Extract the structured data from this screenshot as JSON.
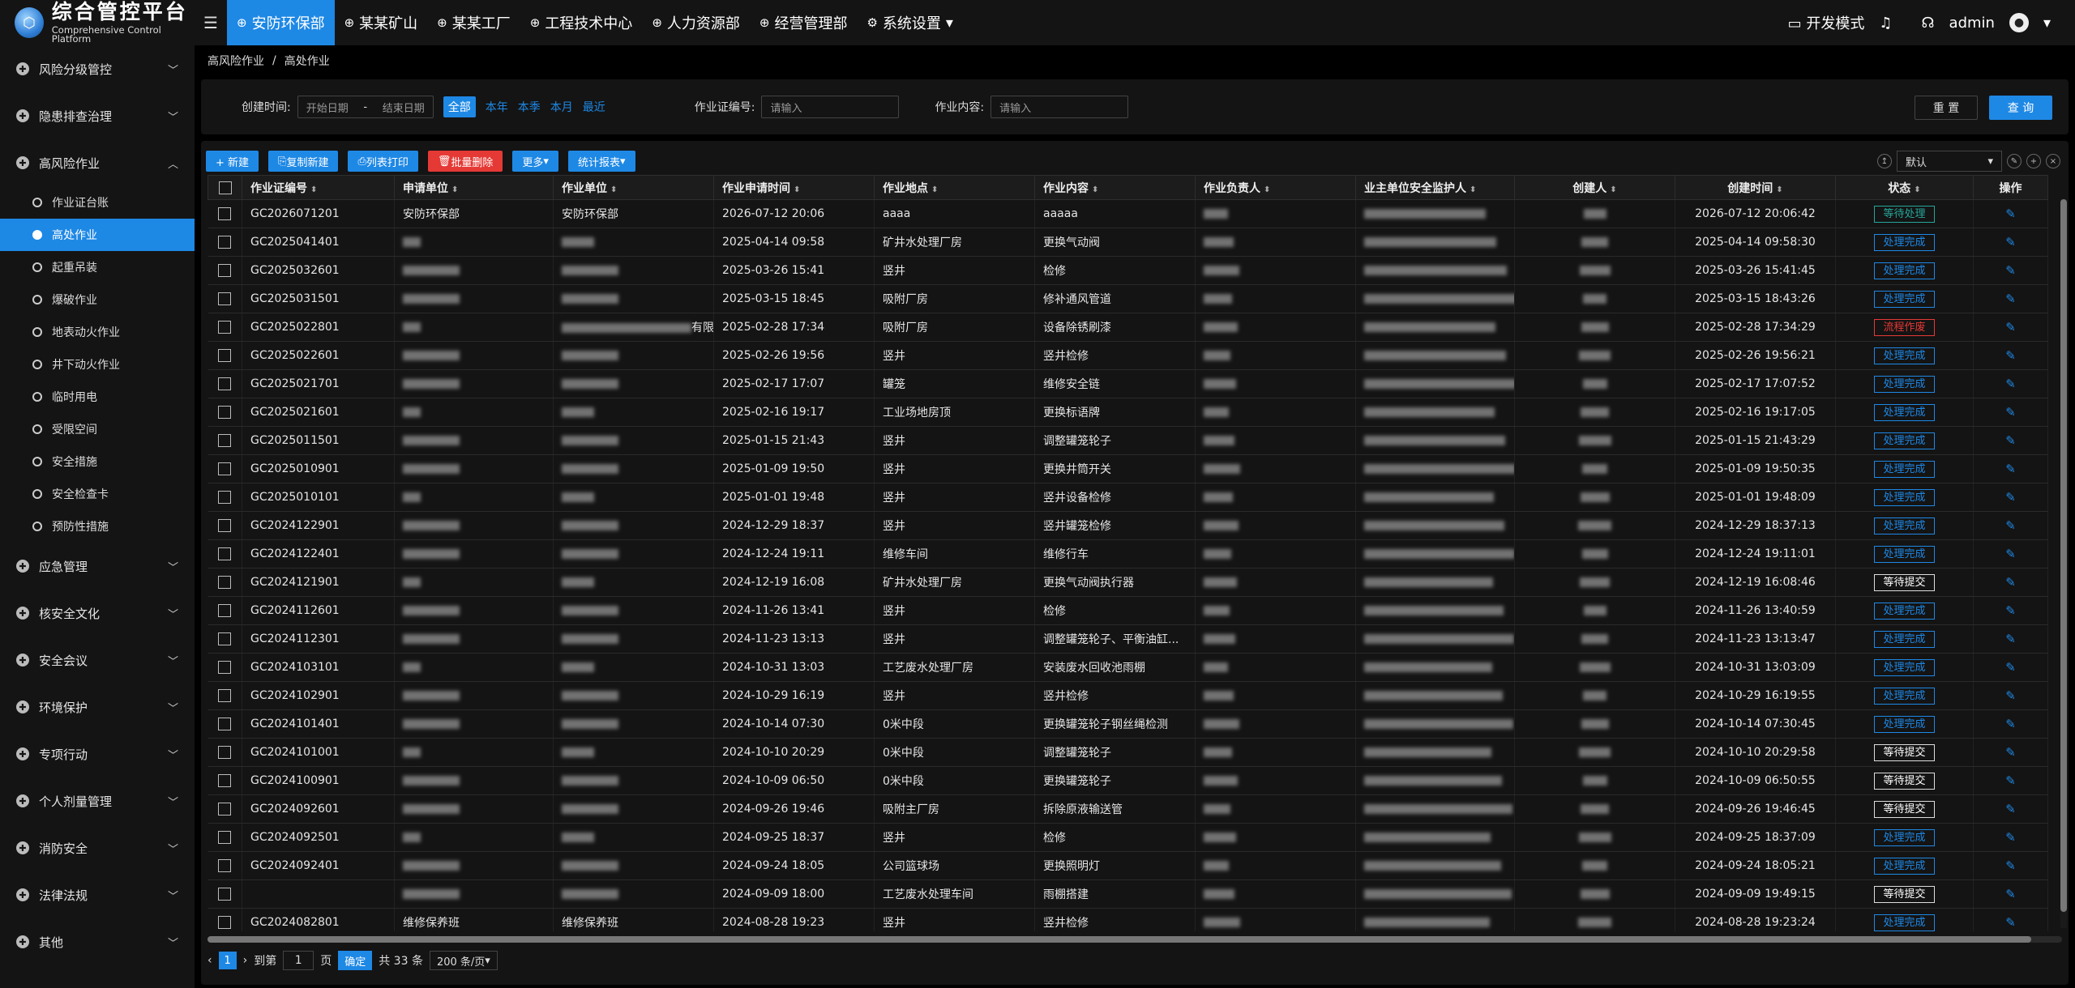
{
  "logo": {
    "title": "综合管控平台",
    "subtitle": "Comprehensive Control Platform"
  },
  "nav": [
    {
      "label": "安防环保部",
      "active": true
    },
    {
      "label": "某某矿山"
    },
    {
      "label": "某某工厂"
    },
    {
      "label": "工程技术中心"
    },
    {
      "label": "人力资源部"
    },
    {
      "label": "经营管理部"
    },
    {
      "label": "系统设置",
      "chevron": "▾"
    }
  ],
  "topright": {
    "devmode": "开发模式",
    "user": "admin"
  },
  "sidebar": {
    "before": [
      "风险分级管控",
      "隐患排查治理"
    ],
    "open": "高风险作业",
    "sub": [
      "作业证台账",
      "高处作业",
      "起重吊装",
      "爆破作业",
      "地表动火作业",
      "井下动火作业",
      "临时用电",
      "受限空间",
      "安全措施",
      "安全检查卡",
      "预防性措施"
    ],
    "after": [
      "应急管理",
      "核安全文化",
      "安全会议",
      "环境保护",
      "专项行动",
      "个人剂量管理",
      "消防安全",
      "法律法规",
      "其他"
    ]
  },
  "breadcrumb": {
    "root": "高风险作业",
    "sep": "/",
    "current": "高处作业"
  },
  "filter": {
    "created_label": "创建时间:",
    "start_ph": "开始日期",
    "dash": "-",
    "end_ph": "结束日期",
    "quick": [
      "全部",
      "本年",
      "本季",
      "本月",
      "最近"
    ],
    "cert_label": "作业证编号:",
    "cert_ph": "请输入",
    "content_label": "作业内容:",
    "content_ph": "请输入",
    "reset": "重 置",
    "query": "查 询"
  },
  "toolbar": {
    "add": "+ 新建",
    "copy": "复制新建",
    "print": "列表打印",
    "del": "批量删除",
    "more": "更多",
    "report": "统计报表",
    "view": "默认"
  },
  "columns": [
    "作业证编号",
    "申请单位",
    "作业单位",
    "作业申请时间",
    "作业地点",
    "作业内容",
    "作业负责人",
    "业主单位安全监护人",
    "创建人",
    "创建时间",
    "状态",
    "操作"
  ],
  "rows": [
    {
      "id": "GC2026071201",
      "apply": "安防环保部",
      "unit": "安防环保部",
      "atime": "2026-07-12 20:06",
      "loc": "aaaa",
      "content": "aaaaa",
      "ctime": "2026-07-12 20:06:42",
      "status": "等待处理",
      "st": "wait"
    },
    {
      "id": "GC2025041401",
      "atime": "2025-04-14 09:58",
      "loc": "矿井水处理厂房",
      "content": "更换气动阀",
      "ctime": "2025-04-14 09:58:30",
      "status": "处理完成",
      "st": "done"
    },
    {
      "id": "GC2025032601",
      "atime": "2025-03-26 15:41",
      "loc": "竖井",
      "content": "检修",
      "ctime": "2025-03-26 15:41:45",
      "status": "处理完成",
      "st": "done"
    },
    {
      "id": "GC2025031501",
      "atime": "2025-03-15 18:45",
      "loc": "吸附厂房",
      "content": "修补通风管道",
      "ctime": "2025-03-15 18:43:26",
      "status": "处理完成",
      "st": "done"
    },
    {
      "id": "GC2025022801",
      "unit": "有限公司",
      "atime": "2025-02-28 17:34",
      "loc": "吸附厂房",
      "content": "设备除锈刷漆",
      "ctime": "2025-02-28 17:34:29",
      "status": "流程作废",
      "st": "abolish"
    },
    {
      "id": "GC2025022601",
      "atime": "2025-02-26 19:56",
      "loc": "竖井",
      "content": "竖井检修",
      "ctime": "2025-02-26 19:56:21",
      "status": "处理完成",
      "st": "done"
    },
    {
      "id": "GC2025021701",
      "atime": "2025-02-17 17:07",
      "loc": "罐笼",
      "content": "维修安全链",
      "ctime": "2025-02-17 17:07:52",
      "status": "处理完成",
      "st": "done"
    },
    {
      "id": "GC2025021601",
      "atime": "2025-02-16 19:17",
      "loc": "工业场地房顶",
      "content": "更换标语牌",
      "ctime": "2025-02-16 19:17:05",
      "status": "处理完成",
      "st": "done"
    },
    {
      "id": "GC2025011501",
      "atime": "2025-01-15 21:43",
      "loc": "竖井",
      "content": "调整罐笼轮子",
      "ctime": "2025-01-15 21:43:29",
      "status": "处理完成",
      "st": "done"
    },
    {
      "id": "GC2025010901",
      "atime": "2025-01-09 19:50",
      "loc": "竖井",
      "content": "更换井筒开关",
      "ctime": "2025-01-09 19:50:35",
      "status": "处理完成",
      "st": "done"
    },
    {
      "id": "GC2025010101",
      "atime": "2025-01-01 19:48",
      "loc": "竖井",
      "content": "竖井设备检修",
      "ctime": "2025-01-01 19:48:09",
      "status": "处理完成",
      "st": "done"
    },
    {
      "id": "GC2024122901",
      "atime": "2024-12-29 18:37",
      "loc": "竖井",
      "content": "竖井罐笼检修",
      "ctime": "2024-12-29 18:37:13",
      "status": "处理完成",
      "st": "done"
    },
    {
      "id": "GC2024122401",
      "atime": "2024-12-24 19:11",
      "loc": "维修车间",
      "content": "维修行车",
      "ctime": "2024-12-24 19:11:01",
      "status": "处理完成",
      "st": "done"
    },
    {
      "id": "GC2024121901",
      "atime": "2024-12-19 16:08",
      "loc": "矿井水处理厂房",
      "content": "更换气动阀执行器",
      "ctime": "2024-12-19 16:08:46",
      "status": "等待提交",
      "st": "submit"
    },
    {
      "id": "GC2024112601",
      "atime": "2024-11-26 13:41",
      "loc": "竖井",
      "content": "检修",
      "ctime": "2024-11-26 13:40:59",
      "status": "处理完成",
      "st": "done"
    },
    {
      "id": "GC2024112301",
      "atime": "2024-11-23 13:13",
      "loc": "竖井",
      "content": "调整罐笼轮子、平衡油缸...",
      "ctime": "2024-11-23 13:13:47",
      "status": "处理完成",
      "st": "done"
    },
    {
      "id": "GC2024103101",
      "atime": "2024-10-31 13:03",
      "loc": "工艺废水处理厂房",
      "content": "安装废水回收池雨棚",
      "ctime": "2024-10-31 13:03:09",
      "status": "处理完成",
      "st": "done"
    },
    {
      "id": "GC2024102901",
      "atime": "2024-10-29 16:19",
      "loc": "竖井",
      "content": "竖井检修",
      "ctime": "2024-10-29 16:19:55",
      "status": "处理完成",
      "st": "done"
    },
    {
      "id": "GC2024101401",
      "atime": "2024-10-14 07:30",
      "loc": "0米中段",
      "content": "更换罐笼轮子钢丝绳检测",
      "ctime": "2024-10-14 07:30:45",
      "status": "处理完成",
      "st": "done"
    },
    {
      "id": "GC2024101001",
      "atime": "2024-10-10 20:29",
      "loc": "0米中段",
      "content": "调整罐笼轮子",
      "ctime": "2024-10-10 20:29:58",
      "status": "等待提交",
      "st": "submit"
    },
    {
      "id": "GC2024100901",
      "atime": "2024-10-09 06:50",
      "loc": "0米中段",
      "content": "更换罐笼轮子",
      "ctime": "2024-10-09 06:50:55",
      "status": "等待提交",
      "st": "submit"
    },
    {
      "id": "GC2024092601",
      "atime": "2024-09-26 19:46",
      "loc": "吸附主厂房",
      "content": "拆除原液输送管",
      "ctime": "2024-09-26 19:46:45",
      "status": "等待提交",
      "st": "submit"
    },
    {
      "id": "GC2024092501",
      "atime": "2024-09-25 18:37",
      "loc": "竖井",
      "content": "检修",
      "ctime": "2024-09-25 18:37:09",
      "status": "处理完成",
      "st": "done"
    },
    {
      "id": "GC2024092401",
      "atime": "2024-09-24 18:05",
      "loc": "公司篮球场",
      "content": "更换照明灯",
      "ctime": "2024-09-24 18:05:21",
      "status": "处理完成",
      "st": "done"
    },
    {
      "id": "",
      "atime": "2024-09-09 18:00",
      "loc": "工艺废水处理车间",
      "content": "雨棚搭建",
      "ctime": "2024-09-09 19:49:15",
      "status": "等待提交",
      "st": "submit"
    },
    {
      "id": "GC2024082801",
      "apply": "维修保养班",
      "unit": "维修保养班",
      "atime": "2024-08-28 19:23",
      "loc": "竖井",
      "content": "竖井检修",
      "ctime": "2024-08-28 19:23:24",
      "status": "处理完成",
      "st": "done"
    }
  ],
  "pager": {
    "page": "1",
    "goto": "到第",
    "page_unit": "页",
    "confirm": "确定",
    "total": "共 33 条",
    "size": "200 条/页"
  }
}
